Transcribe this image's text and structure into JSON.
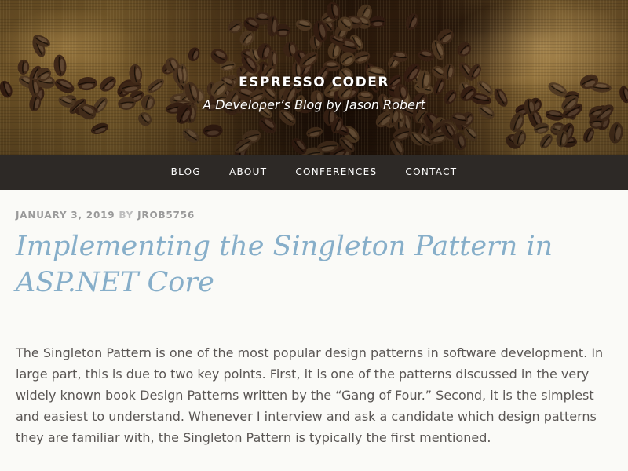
{
  "site": {
    "title": "ESPRESSO CODER",
    "tagline": "A Developer’s Blog by Jason Robert"
  },
  "nav": {
    "items": [
      "BLOG",
      "ABOUT",
      "CONFERENCES",
      "CONTACT"
    ]
  },
  "post": {
    "date": "JANUARY 3, 2019",
    "by": "BY",
    "author": "JROB5756",
    "title": "Implementing the Singleton Pattern in ASP.NET Core",
    "body": "The Singleton Pattern is one of the most popular design patterns in software development. In large part, this is due to two key points. First, it is one of the patterns discussed in the very widely known book Design Patterns written by the “Gang of Four.” Second, it is the simplest and easiest to understand. Whenever I interview and ask a candidate which design patterns they are familiar with, the Singleton Pattern is typically the first mentioned."
  },
  "colors": {
    "nav_bg": "#2d2926",
    "title_blue": "#86aec9",
    "body_text": "#5a5654",
    "meta_gray": "#9a9a9a"
  }
}
